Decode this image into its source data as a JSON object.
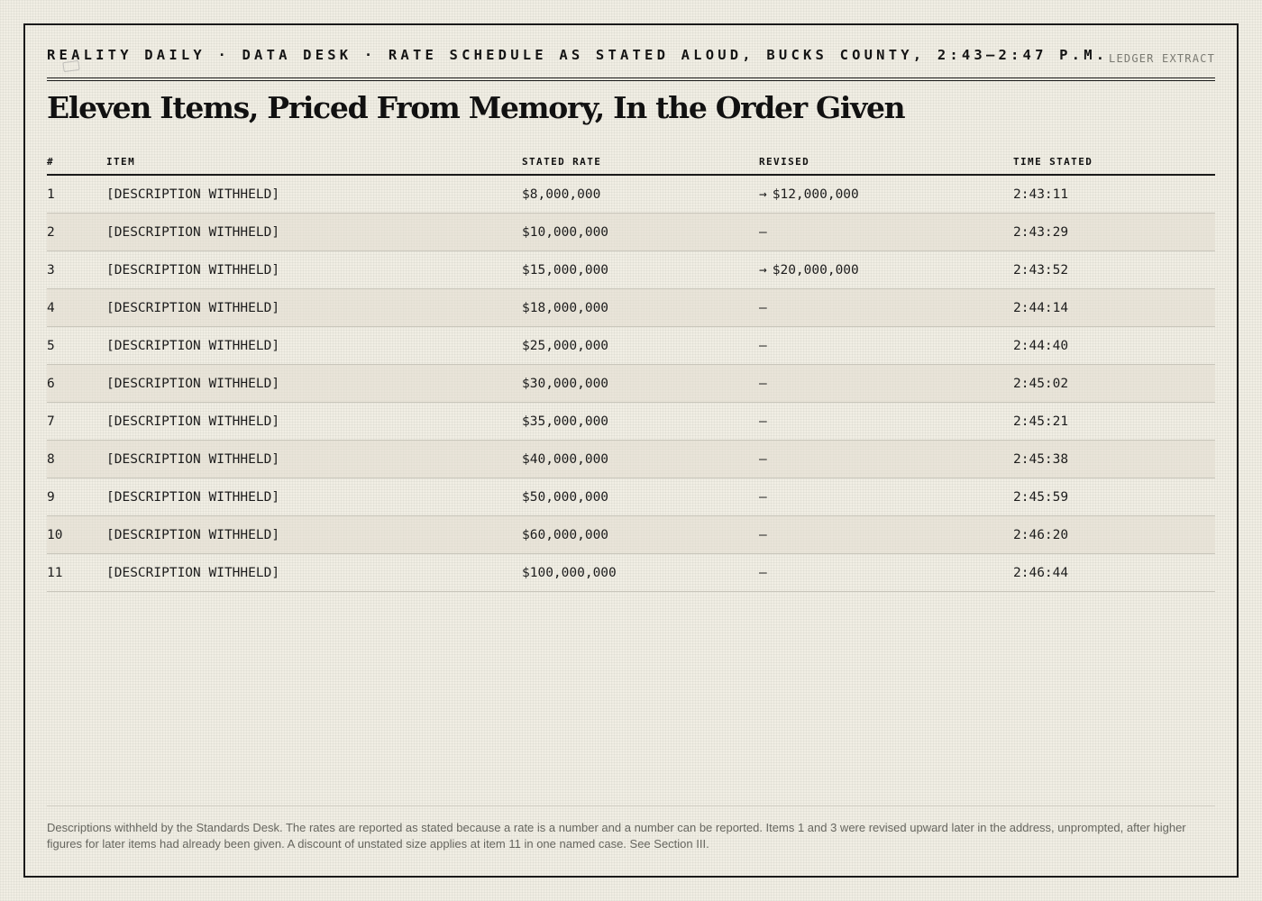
{
  "masthead": {
    "kicker": "REALITY DAILY · DATA DESK · RATE SCHEDULE AS STATED ALOUD, BUCKS COUNTY, 2:43–2:47 P.M.",
    "ledger_label": "LEDGER EXTRACT"
  },
  "headline": "Eleven Items, Priced From Memory, In the Order Given",
  "table": {
    "columns": [
      "#",
      "ITEM",
      "STATED RATE",
      "REVISED",
      "TIME STATED"
    ],
    "rows": [
      {
        "num": "1",
        "item": "[DESCRIPTION WITHHELD]",
        "rate": "$8,000,000",
        "revised": "$12,000,000",
        "revised_arrow": "→",
        "time": "2:43:11"
      },
      {
        "num": "2",
        "item": "[DESCRIPTION WITHHELD]",
        "rate": "$10,000,000",
        "revised": "—",
        "revised_arrow": "",
        "time": "2:43:29"
      },
      {
        "num": "3",
        "item": "[DESCRIPTION WITHHELD]",
        "rate": "$15,000,000",
        "revised": "$20,000,000",
        "revised_arrow": "→",
        "time": "2:43:52"
      },
      {
        "num": "4",
        "item": "[DESCRIPTION WITHHELD]",
        "rate": "$18,000,000",
        "revised": "—",
        "revised_arrow": "",
        "time": "2:44:14"
      },
      {
        "num": "5",
        "item": "[DESCRIPTION WITHHELD]",
        "rate": "$25,000,000",
        "revised": "—",
        "revised_arrow": "",
        "time": "2:44:40"
      },
      {
        "num": "6",
        "item": "[DESCRIPTION WITHHELD]",
        "rate": "$30,000,000",
        "revised": "—",
        "revised_arrow": "",
        "time": "2:45:02"
      },
      {
        "num": "7",
        "item": "[DESCRIPTION WITHHELD]",
        "rate": "$35,000,000",
        "revised": "—",
        "revised_arrow": "",
        "time": "2:45:21"
      },
      {
        "num": "8",
        "item": "[DESCRIPTION WITHHELD]",
        "rate": "$40,000,000",
        "revised": "—",
        "revised_arrow": "",
        "time": "2:45:38"
      },
      {
        "num": "9",
        "item": "[DESCRIPTION WITHHELD]",
        "rate": "$50,000,000",
        "revised": "—",
        "revised_arrow": "",
        "time": "2:45:59"
      },
      {
        "num": "10",
        "item": "[DESCRIPTION WITHHELD]",
        "rate": "$60,000,000",
        "revised": "—",
        "revised_arrow": "",
        "time": "2:46:20"
      },
      {
        "num": "11",
        "item": "[DESCRIPTION WITHHELD]",
        "rate": "$100,000,000",
        "revised": "—",
        "revised_arrow": "",
        "time": "2:46:44"
      }
    ]
  },
  "footnote": "Descriptions withheld by the Standards Desk. The rates are reported as stated because a rate is a number and a number can be reported. Items 1 and 3 were revised upward later in the address, unprompted, after higher figures for later items had already been given. A discount of unstated size applies at item 11 in one named case. See Section III.",
  "colors": {
    "paper": "#f1eee4",
    "ink": "#111111",
    "rule": "#1a1a1a",
    "muted": "#66665f",
    "row_alt": "#e8e4d8"
  }
}
